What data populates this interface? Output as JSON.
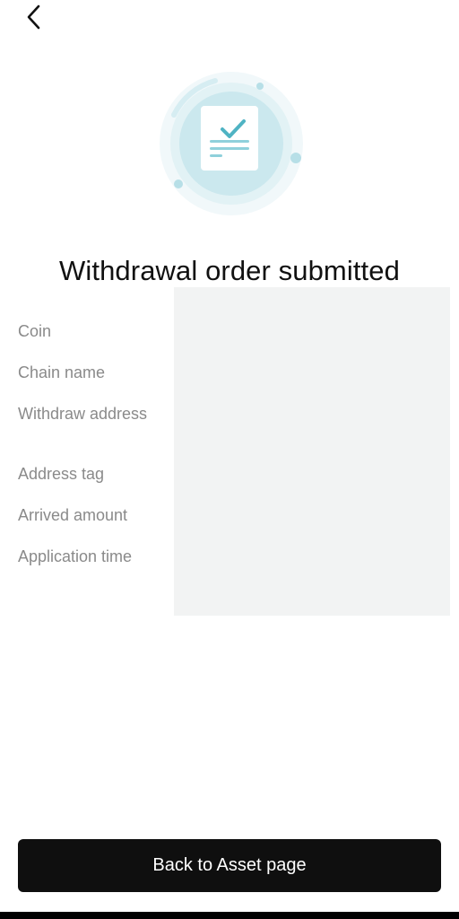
{
  "header": {
    "back_icon": "chevron-left-icon"
  },
  "hero": {
    "icon": "document-check-icon",
    "colors": {
      "outer_ring": "#eef7fa",
      "mid_ring": "#d9eef3",
      "inner_circle": "#bfe3ea",
      "check": "#4fb3c3",
      "lines": "#8fd0db"
    }
  },
  "title": "Withdrawal order submitted",
  "details": {
    "labels": [
      "Coin",
      "Chain name",
      "Withdraw address",
      "Address tag",
      "Arrived amount",
      "Application time"
    ],
    "values_hidden": true
  },
  "actions": {
    "back_to_assets_label": "Back to Asset page"
  },
  "colors": {
    "button_bg": "#0f0f0f",
    "button_text": "#ffffff",
    "label_text": "#8a8a8a",
    "panel_bg": "#f2f3f3"
  }
}
